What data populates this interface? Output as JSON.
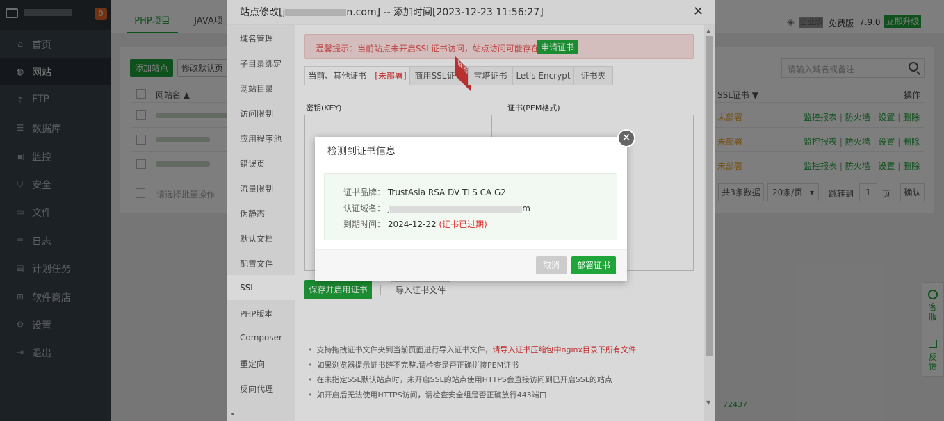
{
  "sidebar": {
    "badge": "0",
    "items": [
      {
        "label": "首页",
        "icon": "home-icon",
        "glyph": "⌂"
      },
      {
        "label": "网站",
        "icon": "globe-icon",
        "glyph": "◍"
      },
      {
        "label": "FTP",
        "icon": "ftp-icon",
        "glyph": "⇡"
      },
      {
        "label": "数据库",
        "icon": "database-icon",
        "glyph": "☰"
      },
      {
        "label": "监控",
        "icon": "monitor-icon",
        "glyph": "▣"
      },
      {
        "label": "安全",
        "icon": "shield-icon",
        "glyph": "⛉"
      },
      {
        "label": "文件",
        "icon": "folder-icon",
        "glyph": "▭"
      },
      {
        "label": "日志",
        "icon": "log-icon",
        "glyph": "≡"
      },
      {
        "label": "计划任务",
        "icon": "calendar-icon",
        "glyph": "▤"
      },
      {
        "label": "软件商店",
        "icon": "apps-icon",
        "glyph": "⊞"
      },
      {
        "label": "设置",
        "icon": "gear-icon",
        "glyph": "⚙"
      },
      {
        "label": "退出",
        "icon": "logout-icon",
        "glyph": "⇥"
      }
    ]
  },
  "topbar": {
    "tabs": [
      "PHP项目",
      "JAVA项"
    ],
    "enterprise": "企业版",
    "free_edition": "免费版",
    "version": "7.9.0",
    "upgrade": "立即升级"
  },
  "site_list": {
    "add_site": "添加站点",
    "modify_default": "修改默认页",
    "search_placeholder": "请输入域名或备注",
    "col_site": "网站名 ▲",
    "col_ssl": "SSL证书 ▼",
    "col_ops": "操作",
    "rows": [
      {
        "ssl": "未部署"
      },
      {
        "ssl": "未部署"
      },
      {
        "ssl": "未部署"
      }
    ],
    "ops": {
      "monitor": "监控报表",
      "firewall": "防火墙",
      "settings": "设置",
      "delete": "删除"
    },
    "batch_placeholder": "请选择批量操作",
    "total": "共3条数据",
    "per_page": "20条/页",
    "goto": "跳转到",
    "page_num": "1",
    "page_unit": "页",
    "confirm": "确认",
    "footer_num": "72437"
  },
  "site_dialog": {
    "title": "站点修改[j",
    "title_suffix": "n.com] -- 添加时间[2023-12-23 11:56:27]",
    "menu": [
      "域名管理",
      "子目录绑定",
      "网站目录",
      "访问限制",
      "应用程序池",
      "错误页",
      "流量限制",
      "伪静态",
      "默认文档",
      "配置文件",
      "SSL",
      "PHP版本",
      "Composer",
      "重定向",
      "反向代理"
    ],
    "warning": "温馨提示：当前站点未开启SSL证书访问，站点访问可能存在风险。",
    "apply_cert": "申请证书",
    "tabs": {
      "current_prefix": "当前、其他证书 - ",
      "current_status": "[未部署]",
      "commercial": "商用SSL证书",
      "ribbon": "推荐",
      "baota": "宝塔证书",
      "letsencrypt": "Let's Encrypt",
      "folder": "证书夹"
    },
    "key_label": "密钥(KEY)",
    "pem_label": "证书(PEM格式)",
    "save_enable": "保存并启用证书",
    "import_cert": "导入证书文件",
    "tips": [
      {
        "text": "支持拖拽证书文件夹到当前页面进行导入证书文件，",
        "highlight": "请导入证书压缩包中nginx目录下所有文件"
      },
      {
        "text": "如果浏览器提示证书链不完整,请检查是否正确拼接PEM证书",
        "highlight": ""
      },
      {
        "text": "在未指定SSL默认站点时，未开启SSL的站点使用HTTPS会直接访问到已开启SSL的站点",
        "highlight": ""
      },
      {
        "text": "如开启后无法使用HTTPS访问，请检查安全组是否正确放行443端口",
        "highlight": ""
      }
    ]
  },
  "cert_popup": {
    "title": "检测到证书信息",
    "brand_label": "证书品牌：",
    "brand_value": "TrustAsia RSA DV TLS CA G2",
    "domain_label": "认证域名：",
    "domain_value_start": "j",
    "domain_value_end": "m",
    "expiry_label": "到期时间：",
    "expiry_value": "2024-12-22",
    "expired_note": "(证书已过期)",
    "cancel": "取消",
    "deploy": "部署证书"
  },
  "float_panel": {
    "service": "客服",
    "feedback": "反馈"
  }
}
